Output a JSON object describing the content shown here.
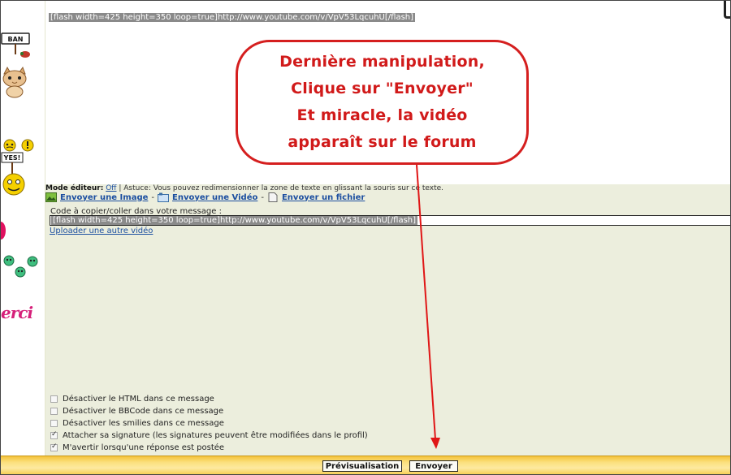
{
  "editor": {
    "content": "[flash width=425 height=350 loop=true]http://www.youtube.com/v/VpV53LqcuhU[/flash]"
  },
  "smileys": {
    "ban_sign": "BAN",
    "yes_sign": "YES!",
    "merci": "erci"
  },
  "mode_line": {
    "label": "Mode éditeur:",
    "value": "Off",
    "tip": " | Astuce: Vous pouvez redimensionner la zone de texte en glissant la souris sur ce texte."
  },
  "upload": {
    "image": "Envoyer une Image",
    "video": "Envoyer une Vidéo",
    "file": "Envoyer un fichier",
    "separator": "-"
  },
  "code": {
    "label": "Code à copier/coller dans votre message :",
    "value": "[flash width=425 height=350 loop=true]http://www.youtube.com/v/VpV53LqcuhU[/flash]",
    "reupload": "Uploader une autre vidéo"
  },
  "options": [
    {
      "label": "Désactiver le HTML dans ce message",
      "checked": false
    },
    {
      "label": "Désactiver le BBCode dans ce message",
      "checked": false
    },
    {
      "label": "Désactiver les smilies dans ce message",
      "checked": false
    },
    {
      "label": "Attacher sa signature (les signatures peuvent être modifiées dans le profil)",
      "checked": true
    },
    {
      "label": "M'avertir lorsqu'une réponse est postée",
      "checked": true
    }
  ],
  "buttons": {
    "preview": "Prévisualisation",
    "send": "Envoyer"
  },
  "callout": {
    "line1": "Dernière manipulation,",
    "line2": "Clique sur \"Envoyer\"",
    "line3": "Et miracle, la vidéo",
    "line4": "apparaît sur le forum"
  },
  "colors": {
    "callout_red": "#d51f1f",
    "link_blue": "#1c4fa0",
    "panel_bg": "#eceedd",
    "bar_yellow": "#f4c23a"
  }
}
